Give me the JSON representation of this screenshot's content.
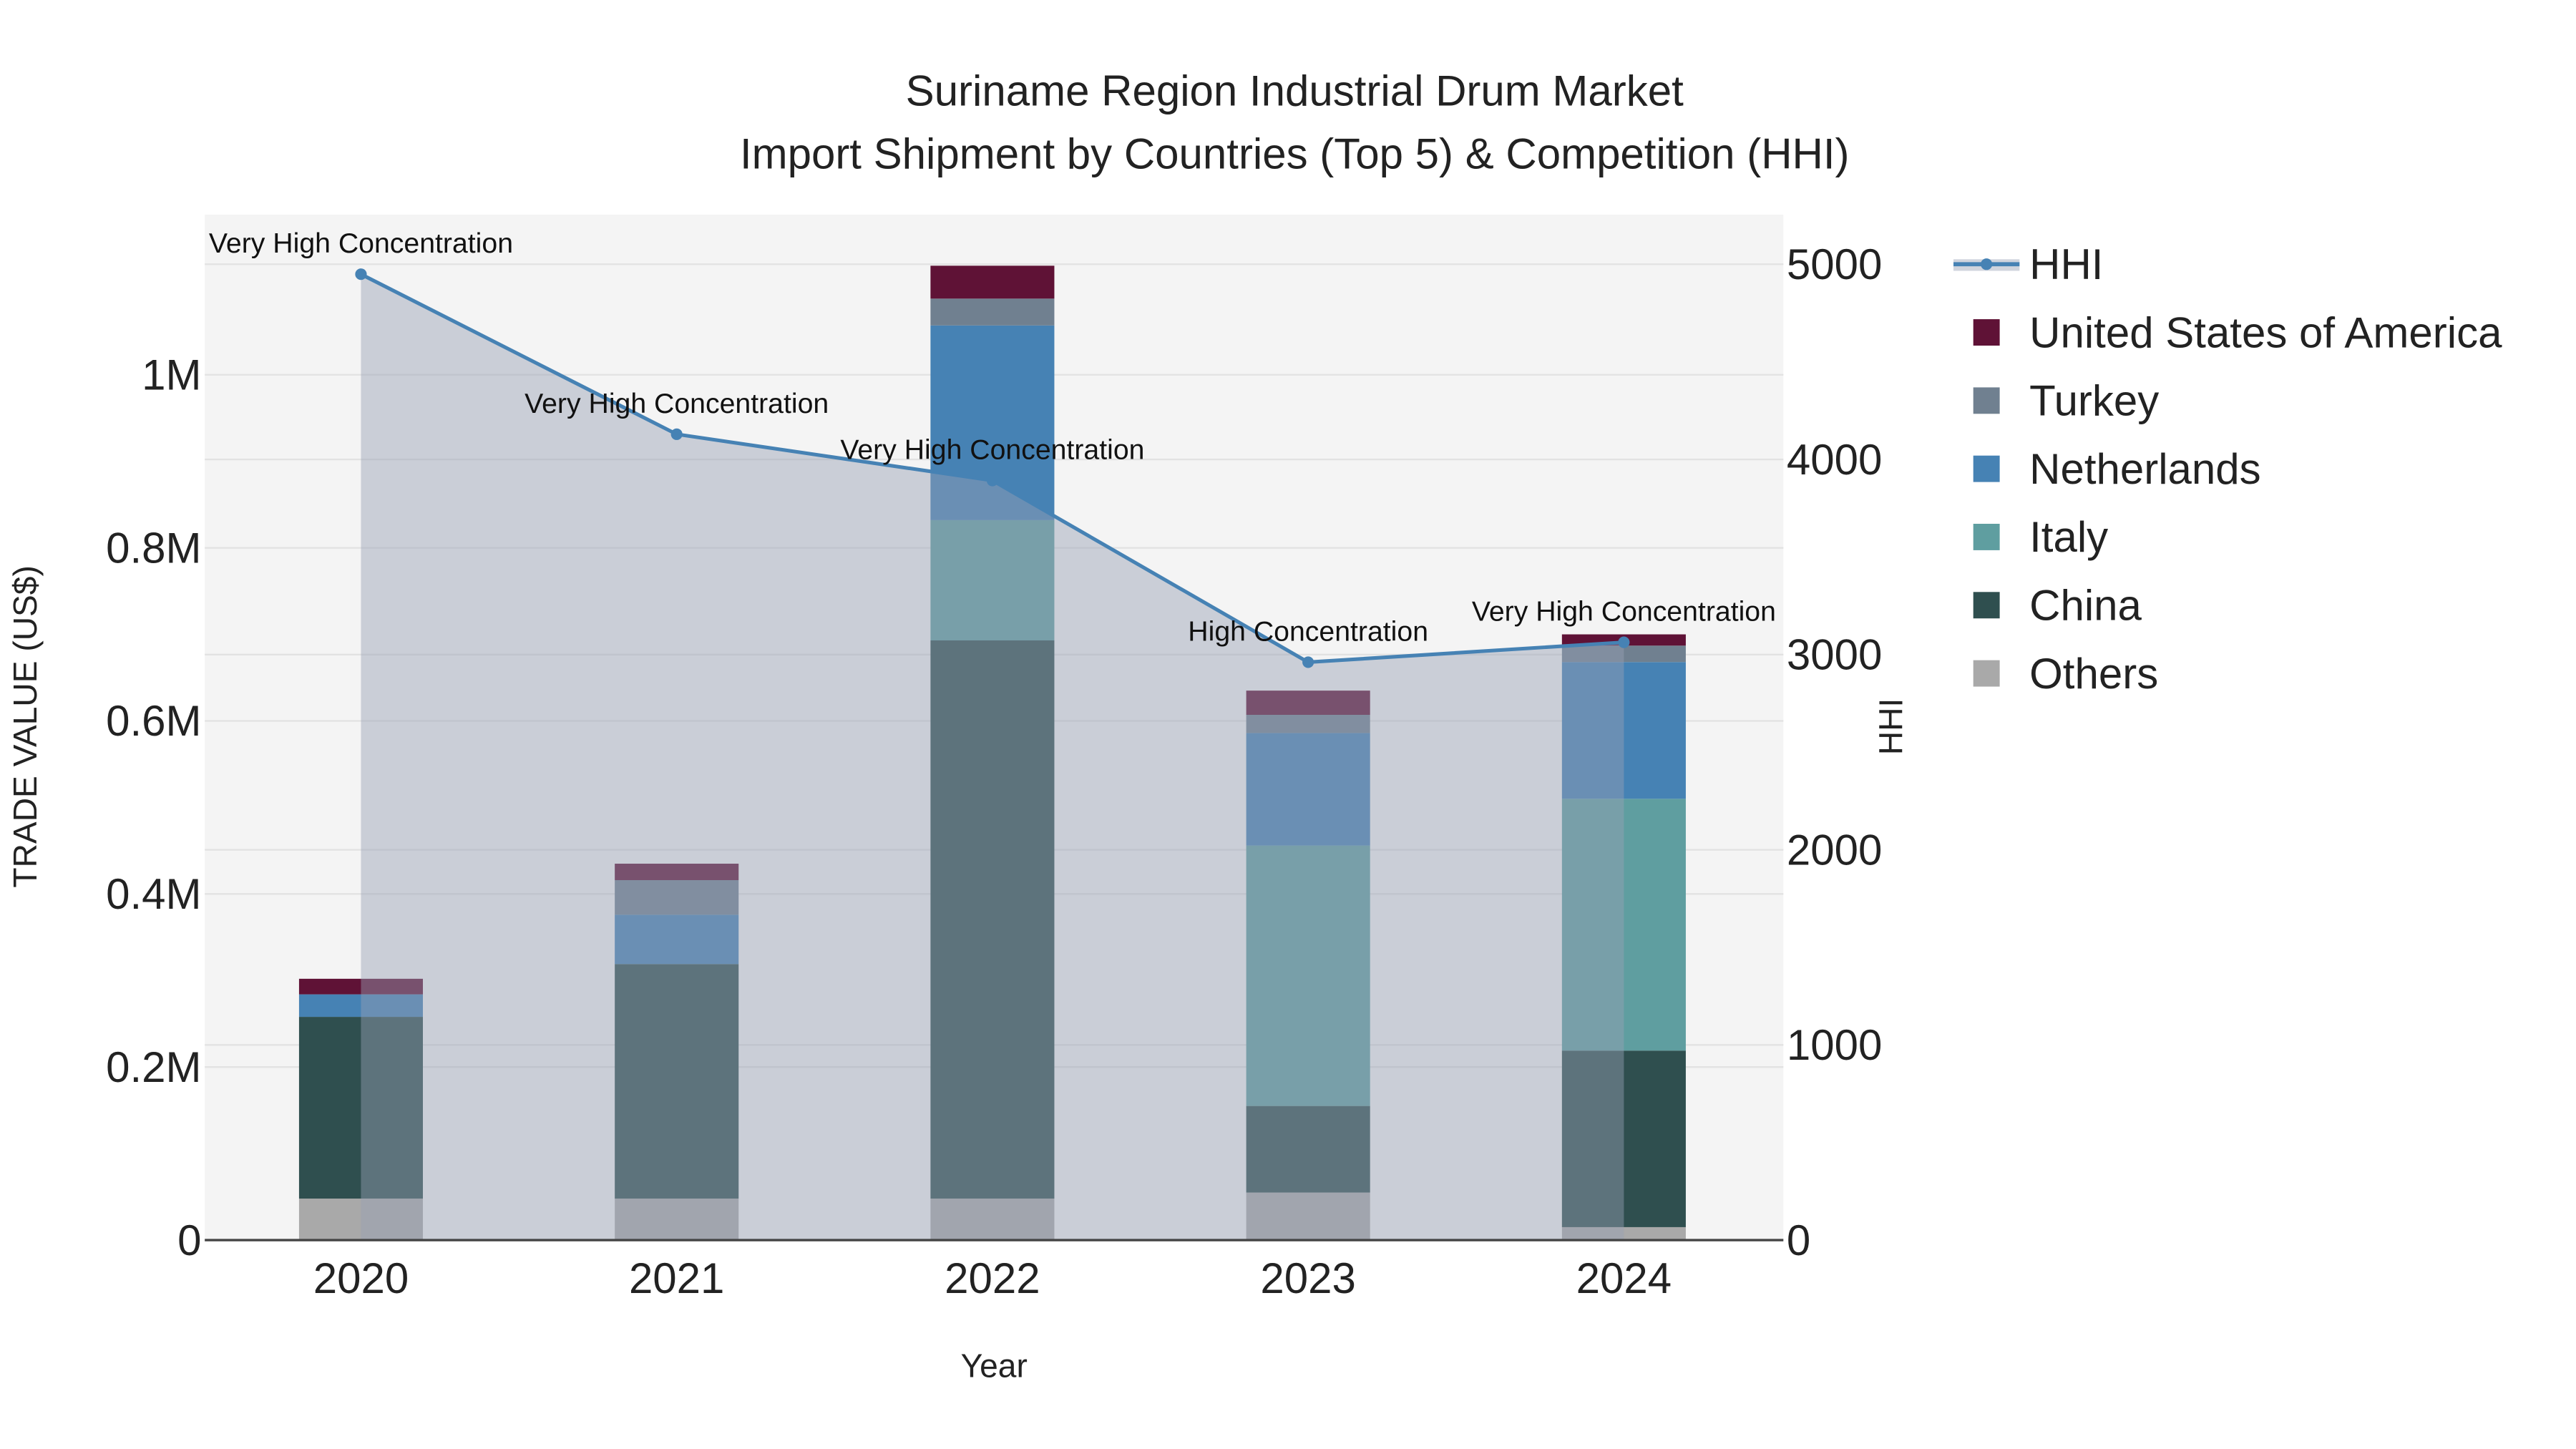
{
  "chart_data": {
    "type": "bar",
    "title": "Suriname Region Industrial Drum Market",
    "subtitle": "Import Shipment by Countries (Top 5) & Competition (HHI)",
    "xlabel": "Year",
    "ylabel": "TRADE VALUE (US$)",
    "y2label": "HHI",
    "categories": [
      "2020",
      "2021",
      "2022",
      "2023",
      "2024"
    ],
    "ylim": [
      0,
      1185000
    ],
    "y2lim": [
      0,
      5254
    ],
    "yticks": [
      {
        "v": 0,
        "label": "0"
      },
      {
        "v": 200000,
        "label": "0.2M"
      },
      {
        "v": 400000,
        "label": "0.4M"
      },
      {
        "v": 600000,
        "label": "0.6M"
      },
      {
        "v": 800000,
        "label": "0.8M"
      },
      {
        "v": 1000000,
        "label": "1M"
      }
    ],
    "y2ticks": [
      {
        "v": 0,
        "label": "0"
      },
      {
        "v": 1000,
        "label": "1000"
      },
      {
        "v": 2000,
        "label": "2000"
      },
      {
        "v": 3000,
        "label": "3000"
      },
      {
        "v": 4000,
        "label": "4000"
      },
      {
        "v": 5000,
        "label": "5000"
      }
    ],
    "grid": true,
    "legend_position": "right",
    "series": [
      {
        "name": "Others",
        "color": "#a9a9a9",
        "values": [
          48000,
          48000,
          48000,
          55000,
          15000
        ]
      },
      {
        "name": "China",
        "color": "#2f4f4f",
        "values": [
          210000,
          271000,
          645000,
          100000,
          204000
        ]
      },
      {
        "name": "Italy",
        "color": "#5f9ea0",
        "values": [
          0,
          0,
          139000,
          301000,
          291000
        ]
      },
      {
        "name": "Netherlands",
        "color": "#4682b4",
        "values": [
          26000,
          57000,
          225000,
          130000,
          158000
        ]
      },
      {
        "name": "Turkey",
        "color": "#708090",
        "values": [
          0,
          40000,
          31000,
          21000,
          19000
        ]
      },
      {
        "name": "United States of America",
        "color": "#5f1236",
        "values": [
          18000,
          19000,
          38000,
          28000,
          13000
        ]
      }
    ],
    "hhi": {
      "name": "HHI",
      "color": "#4682b4",
      "values": [
        4949,
        4129,
        3892,
        2961,
        3063
      ],
      "annotations": [
        "Very High Concentration",
        "Very High Concentration",
        "Very High Concentration",
        "High Concentration",
        "Very High Concentration"
      ]
    },
    "legend_order": [
      "HHI",
      "United States of America",
      "Turkey",
      "Netherlands",
      "Italy",
      "China",
      "Others"
    ]
  }
}
